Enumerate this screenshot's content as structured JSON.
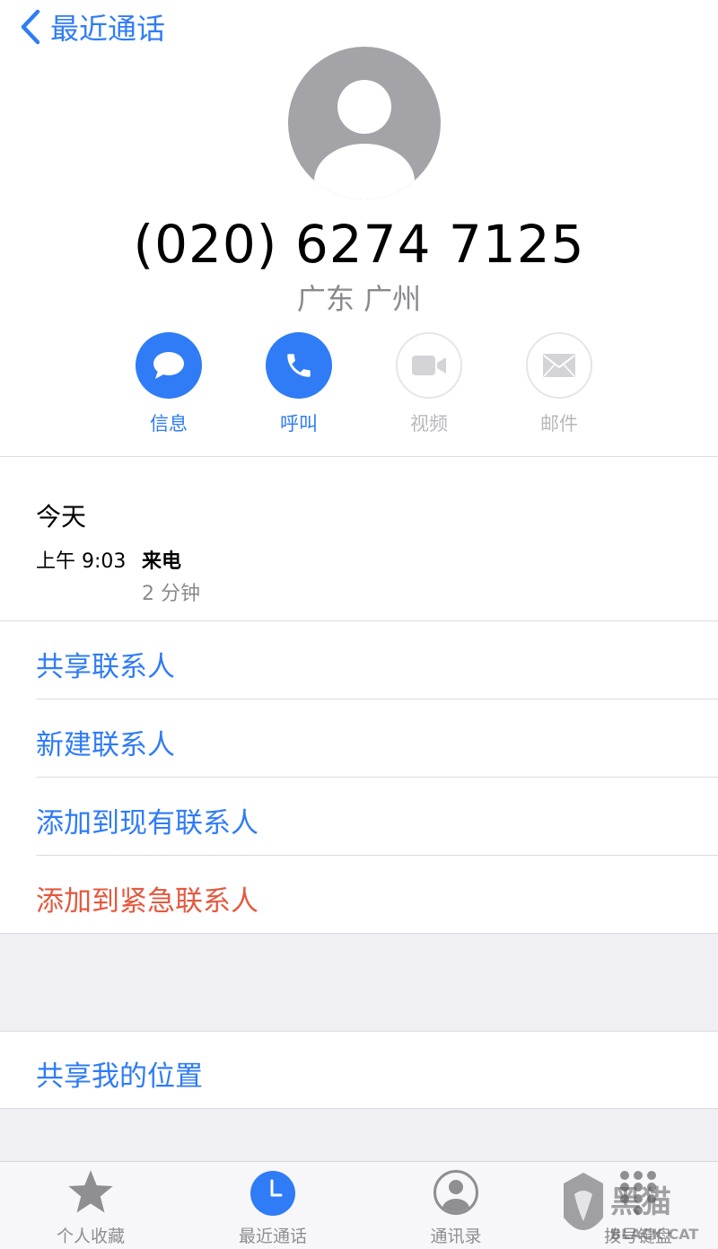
{
  "nav": {
    "back_label": "最近通话"
  },
  "contact": {
    "phone_number": "(020) 6274 7125",
    "location": "广东 广州"
  },
  "actions": [
    {
      "label": "信息",
      "icon": "message-bubble-icon",
      "enabled": true
    },
    {
      "label": "呼叫",
      "icon": "phone-icon",
      "enabled": true
    },
    {
      "label": "视频",
      "icon": "video-camera-icon",
      "enabled": false
    },
    {
      "label": "邮件",
      "icon": "mail-envelope-icon",
      "enabled": false
    }
  ],
  "call_log": {
    "day": "今天",
    "time": "上午 9:03",
    "type": "来电",
    "duration": "2 分钟"
  },
  "options": [
    {
      "label": "共享联系人"
    },
    {
      "label": "新建联系人"
    },
    {
      "label": "添加到现有联系人"
    },
    {
      "label": "添加到紧急联系人"
    }
  ],
  "location_share": {
    "label": "共享我的位置"
  },
  "tabbar": {
    "tabs": [
      {
        "label": "个人收藏",
        "icon": "star-icon",
        "active": false
      },
      {
        "label": "最近通话",
        "icon": "clock-icon",
        "active": true
      },
      {
        "label": "通讯录",
        "icon": "person-circle-icon",
        "active": false
      },
      {
        "label": "拨号键盘",
        "icon": "keypad-icon",
        "active": false
      }
    ]
  },
  "watermark": {
    "text": "黑猫 BLACK CAT"
  },
  "colors": {
    "accent": "#2f7cf6",
    "danger": "#e4593f",
    "secondary_text": "#8a8a8e",
    "separator": "#dcdcde",
    "grouped_background": "#efeff4"
  }
}
